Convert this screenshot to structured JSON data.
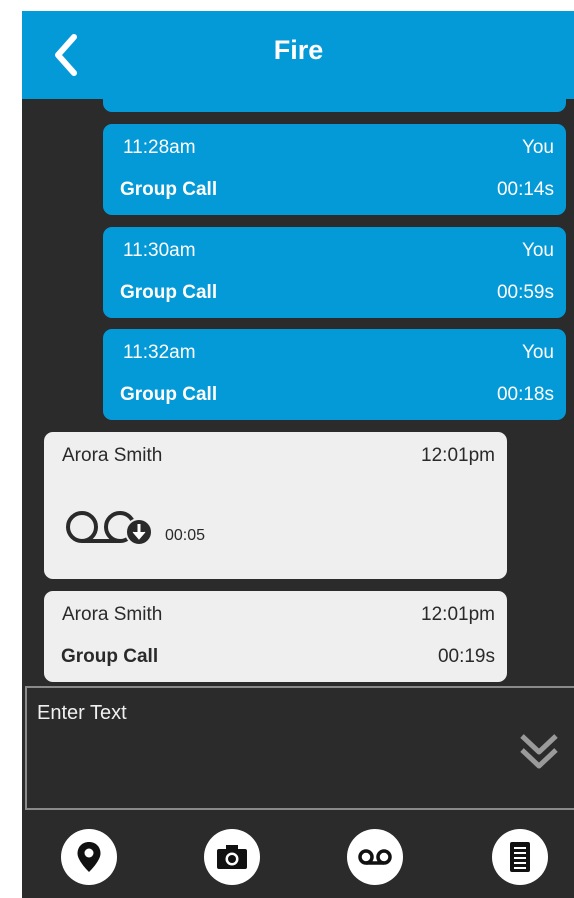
{
  "header": {
    "title": "Fire",
    "back_icon": "chevron-left-icon"
  },
  "messages_outgoing": [
    {
      "time": "11:28am",
      "sender": "You",
      "label": "Group Call",
      "duration": "00:14s"
    },
    {
      "time": "11:30am",
      "sender": "You",
      "label": "Group Call",
      "duration": "00:59s"
    },
    {
      "time": "11:32am",
      "sender": "You",
      "label": "Group Call",
      "duration": "00:18s"
    }
  ],
  "messages_incoming": [
    {
      "sender": "Arora Smith",
      "time": "12:01pm",
      "type": "voicemail",
      "duration": "00:05",
      "icon": "voicemail-icon",
      "badge_icon": "download-icon"
    },
    {
      "sender": "Arora Smith",
      "time": "12:01pm",
      "label": "Group Call",
      "duration": "00:19s"
    }
  ],
  "composer": {
    "placeholder": "Enter Text",
    "expand_icon": "double-chevron-down-icon"
  },
  "toolbar": {
    "items": [
      "location-pin-icon",
      "camera-icon",
      "voicemail-icon",
      "document-icon"
    ]
  },
  "colors": {
    "accent": "#049ad8",
    "background": "#2b2b2b",
    "incoming_bubble": "#efefef"
  }
}
